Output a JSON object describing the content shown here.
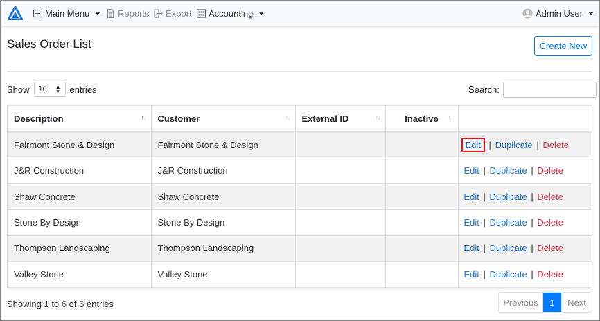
{
  "navbar": {
    "main_menu": "Main Menu",
    "reports": "Reports",
    "export": "Export",
    "accounting": "Accounting",
    "user": "Admin User"
  },
  "header": {
    "title": "Sales Order List",
    "create_button": "Create New"
  },
  "controls": {
    "show_label": "Show",
    "page_size": "10",
    "entries_label": "entries",
    "search_label": "Search:",
    "search_value": ""
  },
  "table": {
    "columns": [
      "Description",
      "Customer",
      "External ID",
      "Inactive"
    ],
    "rows": [
      {
        "description": "Fairmont Stone & Design",
        "customer": "Fairmont Stone & Design",
        "external_id": "",
        "inactive": ""
      },
      {
        "description": "J&R Construction",
        "customer": "J&R Construction",
        "external_id": "",
        "inactive": ""
      },
      {
        "description": "Shaw Concrete",
        "customer": "Shaw Concrete",
        "external_id": "",
        "inactive": ""
      },
      {
        "description": "Stone By Design",
        "customer": "Stone By Design",
        "external_id": "",
        "inactive": ""
      },
      {
        "description": "Thompson Landscaping",
        "customer": "Thompson Landscaping",
        "external_id": "",
        "inactive": ""
      },
      {
        "description": "Valley Stone",
        "customer": "Valley Stone",
        "external_id": "",
        "inactive": ""
      }
    ],
    "actions": {
      "edit": "Edit",
      "duplicate": "Duplicate",
      "delete": "Delete",
      "separator": "|"
    }
  },
  "footer": {
    "info": "Showing 1 to 6 of 6 entries",
    "previous": "Previous",
    "current_page": "1",
    "next": "Next"
  },
  "colors": {
    "primary": "#007bff",
    "danger": "#dc3545",
    "highlight": "#e3121b"
  },
  "icons": {
    "logo": "triangle-logo",
    "main_menu": "list-icon",
    "reports": "document-icon",
    "export": "export-icon",
    "accounting": "calculator-icon",
    "user": "user-avatar-icon"
  }
}
